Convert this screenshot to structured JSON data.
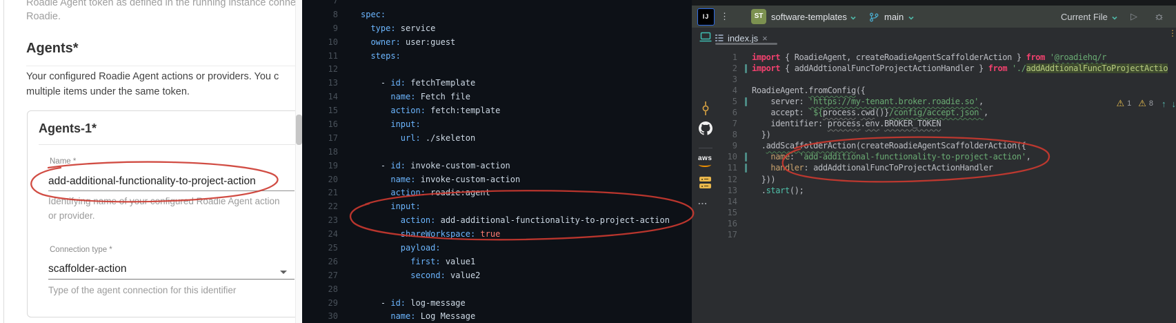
{
  "form_panel": {
    "intro_line1": "Roadie Agent token as defined in the running instance connecting",
    "intro_line2": "Roadie.",
    "agents_heading": "Agents*",
    "agents_desc_line1": "Your configured Roadie Agent actions or providers. You c",
    "agents_desc_line2": "multiple items under the same token.",
    "card": {
      "heading": "Agents-1*",
      "name_label": "Name *",
      "name_value": "add-additional-functionality-to-project-action",
      "name_helper_line1": "Identifying name of your configured Roadie Agent action",
      "name_helper_line2": "or provider.",
      "connection_label": "Connection type *",
      "connection_value": "scaffolder-action",
      "connection_helper": "Type of the agent connection for this identifier"
    }
  },
  "yaml_panel": {
    "lines": [
      {
        "n": "7",
        "t": []
      },
      {
        "n": "8",
        "t": [
          [
            "spec:",
            "k"
          ]
        ]
      },
      {
        "n": "9",
        "t": [
          [
            "  ",
            "p"
          ],
          [
            "type:",
            "k"
          ],
          [
            " service",
            "v"
          ]
        ]
      },
      {
        "n": "10",
        "t": [
          [
            "  ",
            "p"
          ],
          [
            "owner:",
            "k"
          ],
          [
            " user:guest",
            "v"
          ]
        ]
      },
      {
        "n": "11",
        "t": [
          [
            "  ",
            "p"
          ],
          [
            "steps:",
            "k"
          ]
        ]
      },
      {
        "n": "12",
        "t": []
      },
      {
        "n": "13",
        "t": [
          [
            "    - ",
            "p"
          ],
          [
            "id:",
            "k"
          ],
          [
            " fetchTemplate",
            "v"
          ]
        ]
      },
      {
        "n": "14",
        "t": [
          [
            "      ",
            "p"
          ],
          [
            "name:",
            "k"
          ],
          [
            " Fetch file",
            "v"
          ]
        ]
      },
      {
        "n": "15",
        "t": [
          [
            "      ",
            "p"
          ],
          [
            "action:",
            "k"
          ],
          [
            " fetch:template",
            "v"
          ]
        ]
      },
      {
        "n": "16",
        "t": [
          [
            "      ",
            "p"
          ],
          [
            "input:",
            "k"
          ]
        ]
      },
      {
        "n": "17",
        "t": [
          [
            "        ",
            "p"
          ],
          [
            "url:",
            "k"
          ],
          [
            " ./skeleton",
            "v"
          ]
        ]
      },
      {
        "n": "18",
        "t": []
      },
      {
        "n": "19",
        "t": [
          [
            "    - ",
            "p"
          ],
          [
            "id:",
            "k"
          ],
          [
            " invoke-custom-action",
            "v"
          ]
        ]
      },
      {
        "n": "20",
        "t": [
          [
            "      ",
            "p"
          ],
          [
            "name:",
            "k"
          ],
          [
            " invoke-custom-action",
            "v"
          ]
        ]
      },
      {
        "n": "21",
        "t": [
          [
            "      ",
            "p"
          ],
          [
            "action:",
            "k"
          ],
          [
            " roadie:agent",
            "v"
          ]
        ]
      },
      {
        "n": "22",
        "t": [
          [
            "      ",
            "p"
          ],
          [
            "input:",
            "k"
          ]
        ]
      },
      {
        "n": "23",
        "t": [
          [
            "        ",
            "p"
          ],
          [
            "action:",
            "k"
          ],
          [
            " add-additional-functionality-to-project-action",
            "v"
          ]
        ]
      },
      {
        "n": "24",
        "t": [
          [
            "        ",
            "p"
          ],
          [
            "shareWorkspace:",
            "k"
          ],
          [
            " ",
            "p"
          ],
          [
            "true",
            "red"
          ]
        ]
      },
      {
        "n": "25",
        "t": [
          [
            "        ",
            "p"
          ],
          [
            "payload:",
            "k"
          ]
        ]
      },
      {
        "n": "26",
        "t": [
          [
            "          ",
            "p"
          ],
          [
            "first:",
            "k"
          ],
          [
            " value1",
            "v"
          ]
        ]
      },
      {
        "n": "27",
        "t": [
          [
            "          ",
            "p"
          ],
          [
            "second:",
            "k"
          ],
          [
            " value2",
            "v"
          ]
        ]
      },
      {
        "n": "28",
        "t": []
      },
      {
        "n": "29",
        "t": [
          [
            "    - ",
            "p"
          ],
          [
            "id:",
            "k"
          ],
          [
            " log-message",
            "v"
          ]
        ]
      },
      {
        "n": "30",
        "t": [
          [
            "      ",
            "p"
          ],
          [
            "name:",
            "k"
          ],
          [
            " Log Message",
            "v"
          ]
        ]
      }
    ]
  },
  "ide": {
    "titlebar": {
      "logo": "IJ",
      "kebab": "⋮",
      "avatar": "ST",
      "project": "software-templates",
      "branch": "main",
      "run_config": "Current File"
    },
    "tabbar": {
      "tab_label": "index.js",
      "close": "×",
      "kebab": "⋮"
    },
    "inspection_widget": {
      "warning_icon": "⚠",
      "count1": "1",
      "count2": "8",
      "up_arrow": "↑",
      "down_arrow": "↓"
    },
    "editor": {
      "changed_lines": [
        2,
        5,
        10,
        11
      ],
      "lines": [
        {
          "n": "1",
          "t": [
            [
              "import",
              "kw"
            ],
            [
              " { RoadieAgent, createRoadieAgentScaffolderAction } ",
              "txt"
            ],
            [
              "from",
              "kw"
            ],
            [
              " ",
              "txt"
            ],
            [
              "'@roadiehq/r",
              "str wg"
            ]
          ]
        },
        {
          "n": "2",
          "t": [
            [
              "import",
              "kw"
            ],
            [
              " { addAddtionalFuncToProjectActionHandler } ",
              "txt"
            ],
            [
              "from",
              "kw"
            ],
            [
              " ",
              "txt"
            ],
            [
              "'./",
              "str"
            ],
            [
              "addAddtionalFuncToProjectActio",
              "strhl"
            ]
          ]
        },
        {
          "n": "3",
          "t": []
        },
        {
          "n": "4",
          "t": [
            [
              "RoadieAgent.",
              "txt"
            ],
            [
              "fromConfig",
              "txt wg"
            ],
            [
              "({",
              "txt"
            ]
          ]
        },
        {
          "n": "5",
          "t": [
            [
              "    server: ",
              "txt"
            ],
            [
              "'https://my-tenant.broker.roadie.so'",
              "str wg"
            ],
            [
              ",",
              "txt"
            ]
          ]
        },
        {
          "n": "6",
          "t": [
            [
              "    accept: ",
              "txt"
            ],
            [
              "`${",
              "str"
            ],
            [
              "process",
              "txt wgr"
            ],
            [
              ".",
              "txt"
            ],
            [
              "cwd",
              "txt wgr"
            ],
            [
              "()}",
              "txt"
            ],
            [
              "/config/accept.json`",
              "str wg"
            ],
            [
              ",",
              "txt"
            ]
          ]
        },
        {
          "n": "7",
          "t": [
            [
              "    identifier: ",
              "txt"
            ],
            [
              "process",
              "txt wgr"
            ],
            [
              ".",
              "txt"
            ],
            [
              "env",
              "txt wgr"
            ],
            [
              ".",
              "txt"
            ],
            [
              "BROKER_TOKEN",
              "txt wgr"
            ]
          ]
        },
        {
          "n": "8",
          "t": [
            [
              "  })",
              "txt"
            ]
          ]
        },
        {
          "n": "9",
          "t": [
            [
              "  .",
              "txt"
            ],
            [
              "addScaffolderAction",
              "txt wg"
            ],
            [
              "(createRoadieAgentScaffolderAction({",
              "txt"
            ]
          ]
        },
        {
          "n": "10",
          "t": [
            [
              "    ",
              "txt"
            ],
            [
              "name",
              "prop"
            ],
            [
              ": ",
              "txt"
            ],
            [
              "'add-additional-functionality-to-project-action'",
              "str"
            ],
            [
              ",",
              "txt"
            ]
          ]
        },
        {
          "n": "11",
          "t": [
            [
              "    ",
              "txt"
            ],
            [
              "handler",
              "prop"
            ],
            [
              ": ",
              "txt"
            ],
            [
              "addAddtionalFuncToProjectActionHandler",
              "txt"
            ]
          ]
        },
        {
          "n": "12",
          "t": [
            [
              "  }))",
              "txt"
            ]
          ]
        },
        {
          "n": "13",
          "t": [
            [
              "  .",
              "txt"
            ],
            [
              "start",
              "meth"
            ],
            [
              "();",
              "txt"
            ]
          ]
        },
        {
          "n": "14",
          "t": []
        },
        {
          "n": "15",
          "t": []
        },
        {
          "n": "16",
          "t": []
        },
        {
          "n": "17",
          "t": []
        }
      ]
    }
  },
  "icons": {
    "dropdown_arrow": "▾",
    "play": "▷",
    "more_dots": "...",
    "aws_label": "aws"
  },
  "colors": {
    "annotation_red": "#cc3a30",
    "yaml_key_blue": "#6cb6ff",
    "ide_keyword_pink": "#f2416e",
    "string_green": "#6aab73",
    "teal_accent": "#4fb8a8",
    "warning_yellow": "#e8bf4f",
    "avatar_green": "#7c9150"
  }
}
